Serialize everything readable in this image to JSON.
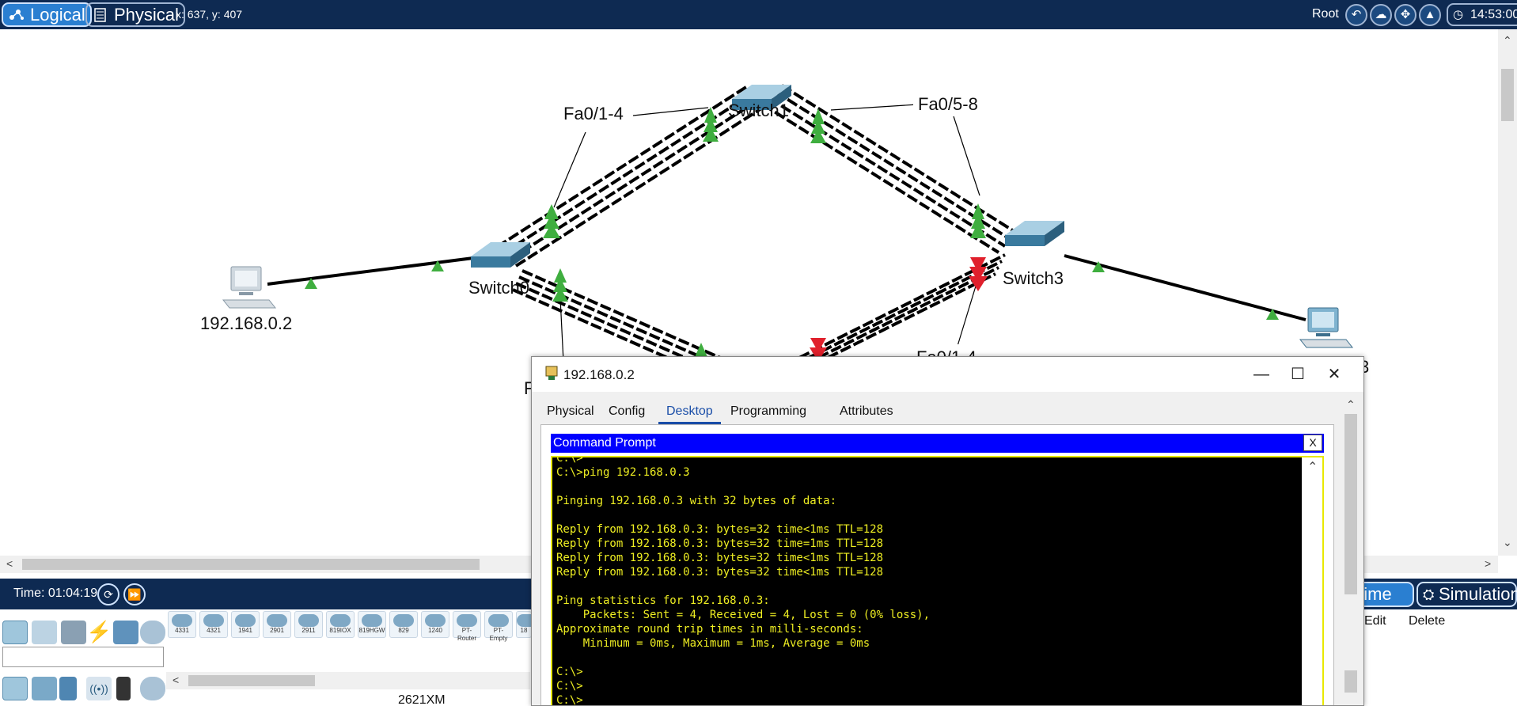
{
  "topbar": {
    "logical_label": "Logical",
    "physical_label": "Physical",
    "coords": "x: 637, y: 407",
    "root_label": "Root",
    "clock": "14:53:00",
    "accent": "#2a7fd1",
    "bar_color": "#0e2a52"
  },
  "topology": {
    "devices": {
      "pc_left": "192.168.0.2",
      "pc_right_partial": "3",
      "switch0": "Switch0",
      "switch1": "Switch1",
      "switch3": "Switch3",
      "switch2_partial": "F"
    },
    "port_labels": {
      "s1_left": "Fa0/1-4",
      "s1_right": "Fa0/5-8",
      "s3_lower_partial": "Fa0/1-4"
    },
    "link_up_color": "#3fae3f",
    "link_down_color": "#e0202c"
  },
  "bottombar": {
    "time": "Time: 01:04:19",
    "realtime_label": "Realtime",
    "realtime_visible": "altime",
    "simulation_label": "Simulation",
    "edit_label": "Edit",
    "delete_label": "Delete"
  },
  "device_panel": {
    "models": [
      "4331",
      "4321",
      "1941",
      "2901",
      "2911",
      "819IOX",
      "819HGW",
      "829",
      "1240",
      "PT-Router",
      "PT-Empty",
      "18"
    ],
    "selected_model": "2621XM"
  },
  "pc_window": {
    "title": "192.168.0.2",
    "tabs": [
      "Physical",
      "Config",
      "Desktop",
      "Programming",
      "Attributes"
    ],
    "active_tab": "Desktop",
    "minimize": "—",
    "maximize": "☐",
    "close": "✕",
    "cmd_title": "Command Prompt",
    "cmd_close": "X",
    "terminal_lines": [
      "C:\\>",
      "C:\\>ping 192.168.0.3",
      "",
      "Pinging 192.168.0.3 with 32 bytes of data:",
      "",
      "Reply from 192.168.0.3: bytes=32 time<1ms TTL=128",
      "Reply from 192.168.0.3: bytes=32 time=1ms TTL=128",
      "Reply from 192.168.0.3: bytes=32 time<1ms TTL=128",
      "Reply from 192.168.0.3: bytes=32 time<1ms TTL=128",
      "",
      "Ping statistics for 192.168.0.3:",
      "    Packets: Sent = 4, Received = 4, Lost = 0 (0% loss),",
      "Approximate round trip times in milli-seconds:",
      "    Minimum = 0ms, Maximum = 1ms, Average = 0ms",
      "",
      "C:\\>",
      "C:\\>",
      "C:\\>"
    ]
  }
}
